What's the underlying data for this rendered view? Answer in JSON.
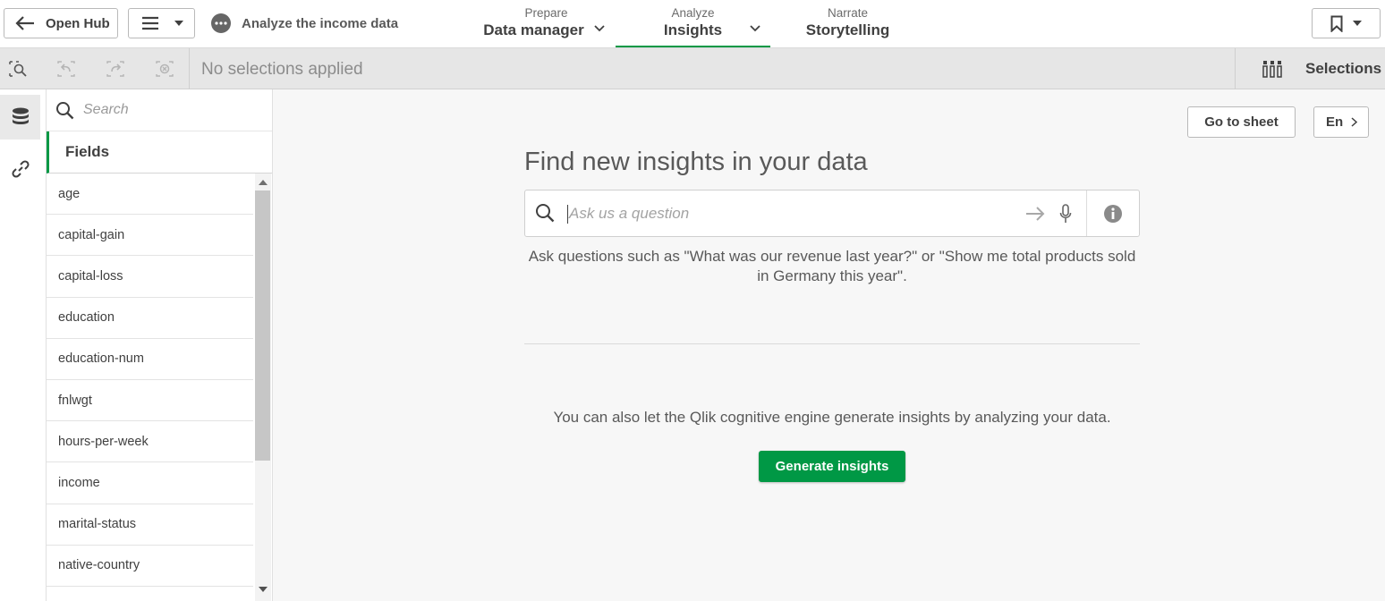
{
  "topbar": {
    "open_hub_label": "Open Hub",
    "app_title": "Analyze the income data",
    "tabs": [
      {
        "sub": "Prepare",
        "main": "Data manager"
      },
      {
        "sub": "Analyze",
        "main": "Insights"
      },
      {
        "sub": "Narrate",
        "main": "Storytelling"
      }
    ]
  },
  "selbar": {
    "status": "No selections applied",
    "selections_label": "Selections"
  },
  "fields_panel": {
    "search_placeholder": "Search",
    "header": "Fields",
    "items": [
      "age",
      "capital-gain",
      "capital-loss",
      "education",
      "education-num",
      "fnlwgt",
      "hours-per-week",
      "income",
      "marital-status",
      "native-country"
    ]
  },
  "main": {
    "goto_sheet_label": "Go to sheet",
    "language_label": "En",
    "headline": "Find new insights in your data",
    "ask_placeholder": "Ask us a question",
    "hint": "Ask questions such as \"What was our revenue last year?\" or \"Show me total products sold in Germany this year\".",
    "also_text": "You can also let the Qlik cognitive engine generate insights by analyzing your data.",
    "generate_label": "Generate insights"
  },
  "colors": {
    "accent_green": "#009845",
    "selection_bar": "#e6e6e6"
  }
}
